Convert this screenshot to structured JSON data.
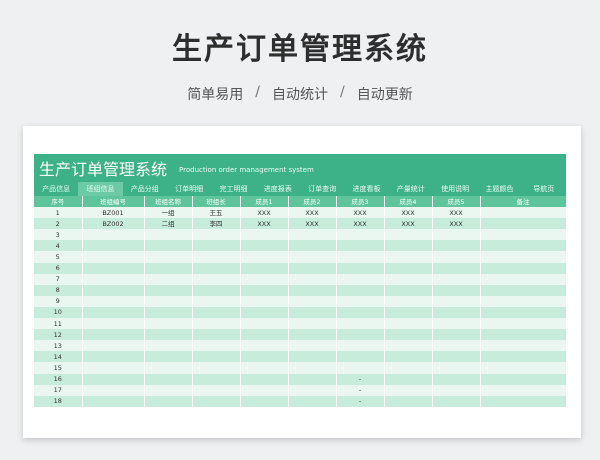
{
  "page": {
    "title": "生产订单管理系统",
    "subtitle_items": [
      "简单易用",
      "自动统计",
      "自动更新"
    ],
    "separator": "/"
  },
  "sheet": {
    "title": "生产订单管理系统",
    "subtitle": "Production order management system",
    "tabs": [
      "产品信息",
      "班组信息",
      "产品分组",
      "订单明细",
      "完工明细",
      "进度报表",
      "订单查询",
      "进度看板",
      "产量统计",
      "使用说明",
      "主题颜色",
      "导航页"
    ],
    "active_tab_index": 1,
    "columns": [
      "序号",
      "班组编号",
      "班组名称",
      "班组长",
      "成员1",
      "成员2",
      "成员3",
      "成员4",
      "成员5",
      "备注"
    ],
    "rows": [
      [
        "1",
        "BZ001",
        "一组",
        "王五",
        "XXX",
        "XXX",
        "XXX",
        "XXX",
        "XXX",
        ""
      ],
      [
        "2",
        "BZ002",
        "二组",
        "李四",
        "XXX",
        "XXX",
        "XXX",
        "XXX",
        "XXX",
        ""
      ],
      [
        "3",
        "",
        "",
        "",
        "",
        "",
        "",
        "",
        "",
        ""
      ],
      [
        "4",
        "",
        "",
        "",
        "",
        "",
        "",
        "",
        "",
        ""
      ],
      [
        "5",
        "",
        "",
        "",
        "",
        "",
        "",
        "",
        "",
        ""
      ],
      [
        "6",
        "",
        "",
        "",
        "",
        "",
        "",
        "",
        "",
        ""
      ],
      [
        "7",
        "",
        "",
        "",
        "",
        "",
        "",
        "",
        "",
        ""
      ],
      [
        "8",
        "",
        "",
        "",
        "",
        "",
        "",
        "",
        "",
        ""
      ],
      [
        "9",
        "",
        "",
        "",
        "",
        "",
        "",
        "",
        "",
        ""
      ],
      [
        "10",
        "",
        "",
        "",
        "",
        "",
        "",
        "",
        "",
        ""
      ],
      [
        "11",
        "",
        "",
        "",
        "",
        "",
        "",
        "",
        "",
        ""
      ],
      [
        "12",
        "",
        "",
        "",
        "",
        "",
        "",
        "",
        "",
        ""
      ],
      [
        "13",
        "",
        "",
        "",
        "",
        "",
        "",
        "",
        "",
        ""
      ],
      [
        "14",
        "",
        "",
        "",
        "",
        "",
        "",
        "",
        "",
        ""
      ],
      [
        "15",
        "",
        "",
        "",
        "",
        "",
        "",
        "",
        "",
        ""
      ],
      [
        "16",
        "",
        "",
        "",
        "",
        "",
        "-",
        "",
        "",
        ""
      ],
      [
        "17",
        "",
        "",
        "",
        "",
        "",
        "-",
        "",
        "",
        ""
      ],
      [
        "18",
        "",
        "",
        "",
        "",
        "",
        "-",
        "",
        "",
        ""
      ]
    ]
  },
  "colors": {
    "header_green": "#3db289",
    "active_tab": "#6ccaa7",
    "column_header": "#5dc49c",
    "row_light": "#e9f7f0",
    "row_dark": "#c8ecdc"
  }
}
